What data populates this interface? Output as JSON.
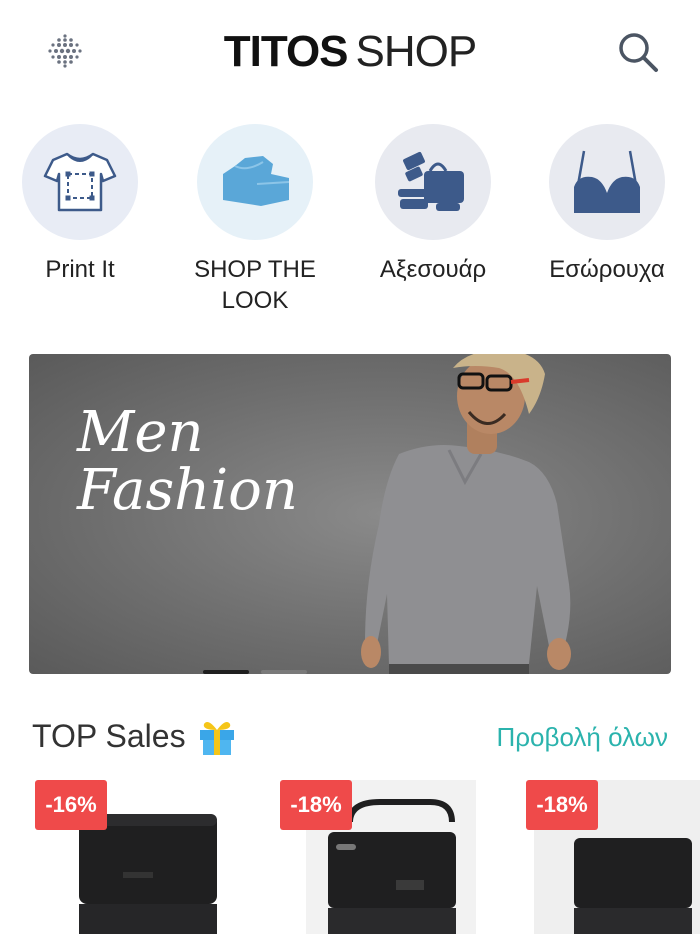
{
  "header": {
    "logo_bold": "TITOS",
    "logo_light": "SHOP"
  },
  "categories": [
    {
      "label": "Print It",
      "icon": "tshirt-print-icon",
      "bg": "#e8ecf5"
    },
    {
      "label": "SHOP THE LOOK",
      "icon": "clothes-stack-icon",
      "bg": "#e6f1f8"
    },
    {
      "label": "Αξεσουάρ",
      "icon": "accessories-icon",
      "bg": "#e8eaf0"
    },
    {
      "label": "Εσώρουχα",
      "icon": "bra-icon",
      "bg": "#e8eaf0"
    }
  ],
  "banner": {
    "title_line1": "Men",
    "title_line2": "Fashion"
  },
  "top_sales": {
    "title": "TOP Sales",
    "view_all": "Προβολή όλων",
    "products": [
      {
        "discount": "-16%"
      },
      {
        "discount": "-18%"
      },
      {
        "discount": "-18%"
      }
    ]
  },
  "colors": {
    "accent": "#2bb3ad",
    "discount": "#ef4a4a",
    "icon_blue": "#3d5a8a",
    "icon_light_blue": "#5aa7d8"
  }
}
